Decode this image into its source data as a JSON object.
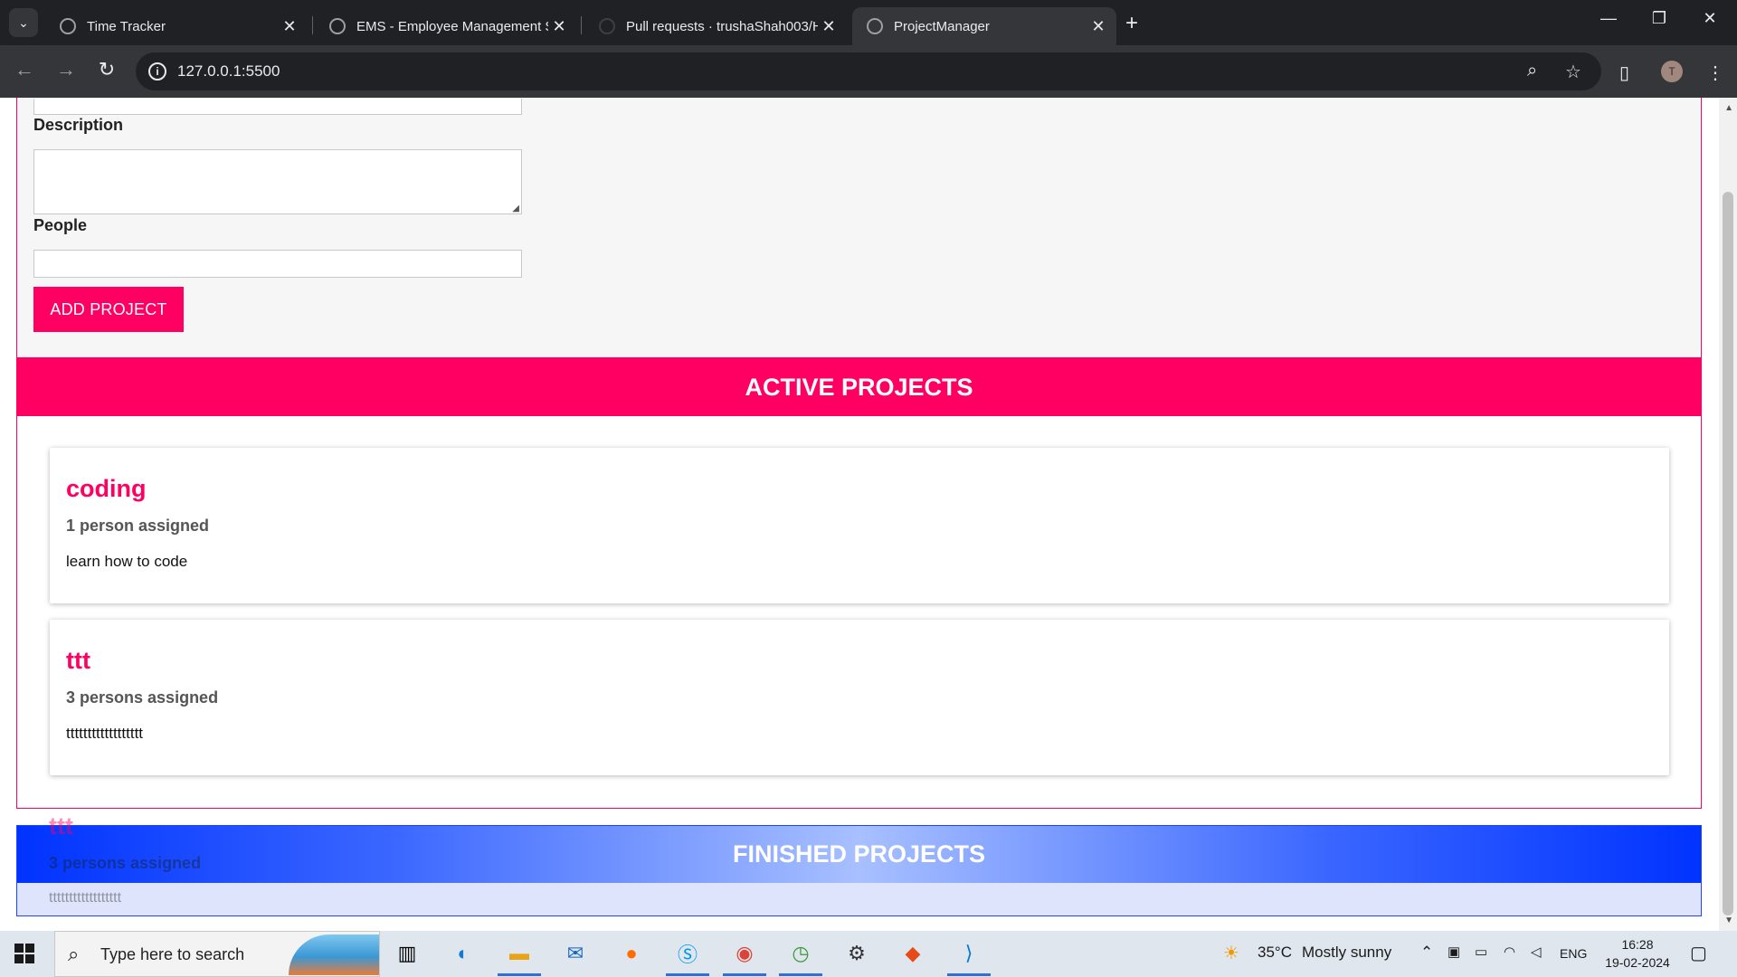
{
  "browser": {
    "tabs": [
      {
        "title": "Time Tracker",
        "active": false
      },
      {
        "title": "EMS - Employee Management S",
        "active": false
      },
      {
        "title": "Pull requests · trushaShah003/H",
        "active": false
      },
      {
        "title": "ProjectManager",
        "active": true
      }
    ],
    "close_glyph": "✕",
    "newtab_glyph": "+",
    "url": "127.0.0.1:5500",
    "profile_initial": "T"
  },
  "page": {
    "form": {
      "description_label": "Description",
      "people_label": "People",
      "add_button": "ADD PROJECT"
    },
    "active": {
      "heading": "ACTIVE PROJECTS",
      "projects": [
        {
          "title": "coding",
          "people": "1 person assigned",
          "description": "learn how to code"
        },
        {
          "title": "ttt",
          "people": "3 persons assigned",
          "description": "tttttttttttttttttt"
        }
      ]
    },
    "finished": {
      "heading": "FINISHED PROJECTS",
      "dragging": {
        "title": "ttt",
        "people": "3 persons assigned",
        "description": "tttttttttttttttttt"
      }
    }
  },
  "taskbar": {
    "search_placeholder": "Type here to search",
    "weather_temp": "35°C",
    "weather_text": "Mostly sunny",
    "language": "ENG",
    "time": "16:28",
    "date": "19-02-2024"
  },
  "colors": {
    "accent": "#ff0062",
    "finished": "#0033ff"
  }
}
